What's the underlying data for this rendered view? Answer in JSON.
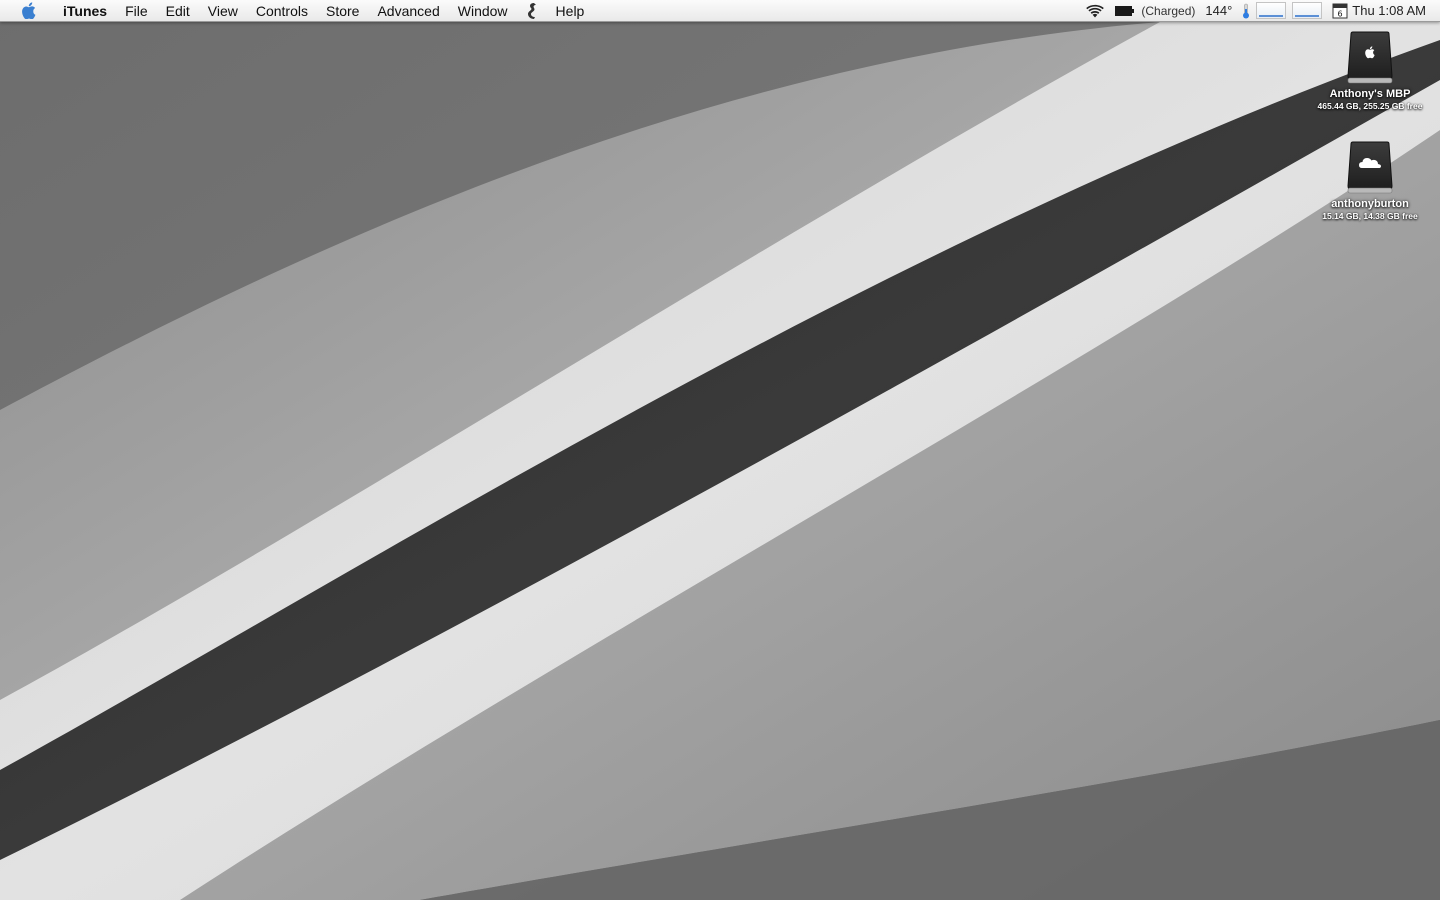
{
  "menubar": {
    "app_name": "iTunes",
    "menus": [
      "File",
      "Edit",
      "View",
      "Controls",
      "Store",
      "Advanced",
      "Window",
      "Help"
    ],
    "status": {
      "battery_label": "(Charged)",
      "temperature": "144°",
      "calendar_day": "6",
      "clock": "Thu 1:08 AM"
    }
  },
  "desktop_icons": [
    {
      "name": "Anthony's MBP",
      "info": "465.44 GB, 255.25 GB free",
      "icon": "hard-drive-apple-icon"
    },
    {
      "name": "anthonyburton",
      "info": "15.14 GB, 14.38 GB free",
      "icon": "icloud-drive-icon"
    }
  ],
  "colors": {
    "wallpaper_dark": "#2f2f2f",
    "wallpaper_light": "#dcdcdc",
    "accent_blue": "#2f7de1"
  }
}
